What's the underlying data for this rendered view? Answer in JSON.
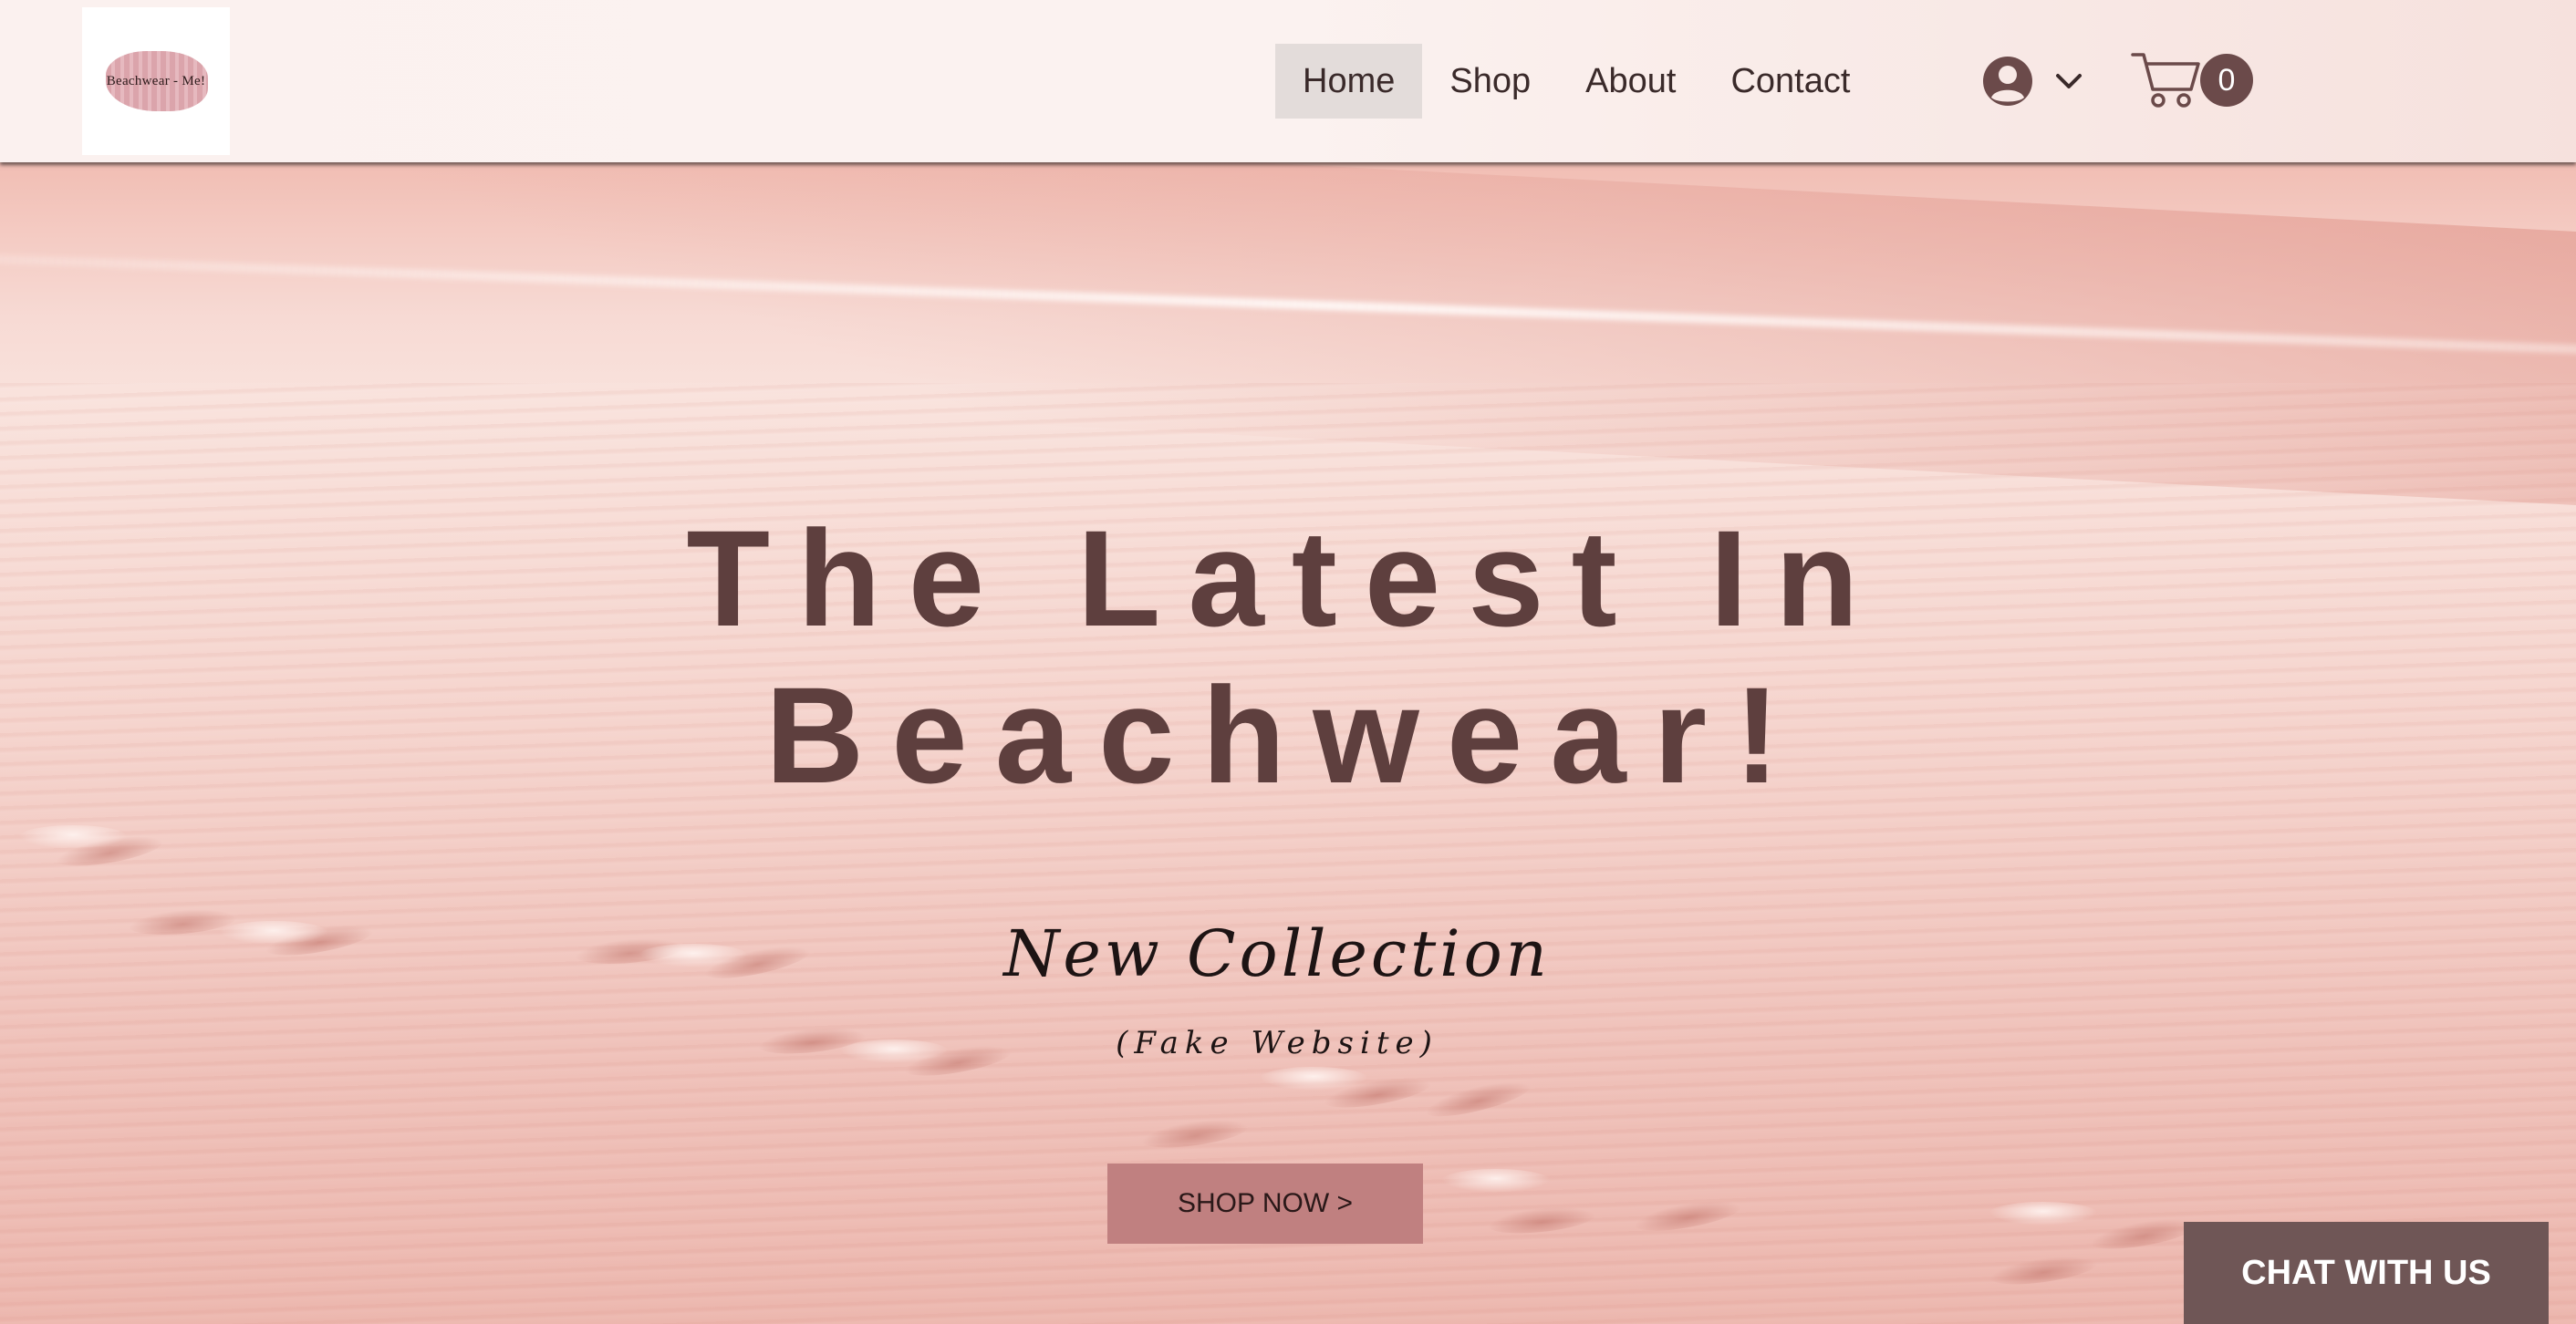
{
  "header": {
    "logo_text": "Beachwear - Me!",
    "nav": [
      {
        "label": "Home",
        "active": true
      },
      {
        "label": "Shop",
        "active": false
      },
      {
        "label": "About",
        "active": false
      },
      {
        "label": "Contact",
        "active": false
      }
    ],
    "account_icon": "user-avatar-icon",
    "cart_icon": "shopping-cart-icon",
    "cart_count": "0"
  },
  "hero": {
    "title_line1": "The Latest In",
    "title_line2": "Beachwear!",
    "subtitle": "New Collection",
    "note": "(Fake Website)",
    "cta_label": "SHOP NOW >"
  },
  "chat": {
    "label": "CHAT WITH US"
  },
  "colors": {
    "title": "#5e3f3e",
    "cta_bg": "#c08080",
    "chat_bg": "#6f5656",
    "cart_badge": "#6b4a4a",
    "active_nav_bg": "#e3dcda"
  }
}
